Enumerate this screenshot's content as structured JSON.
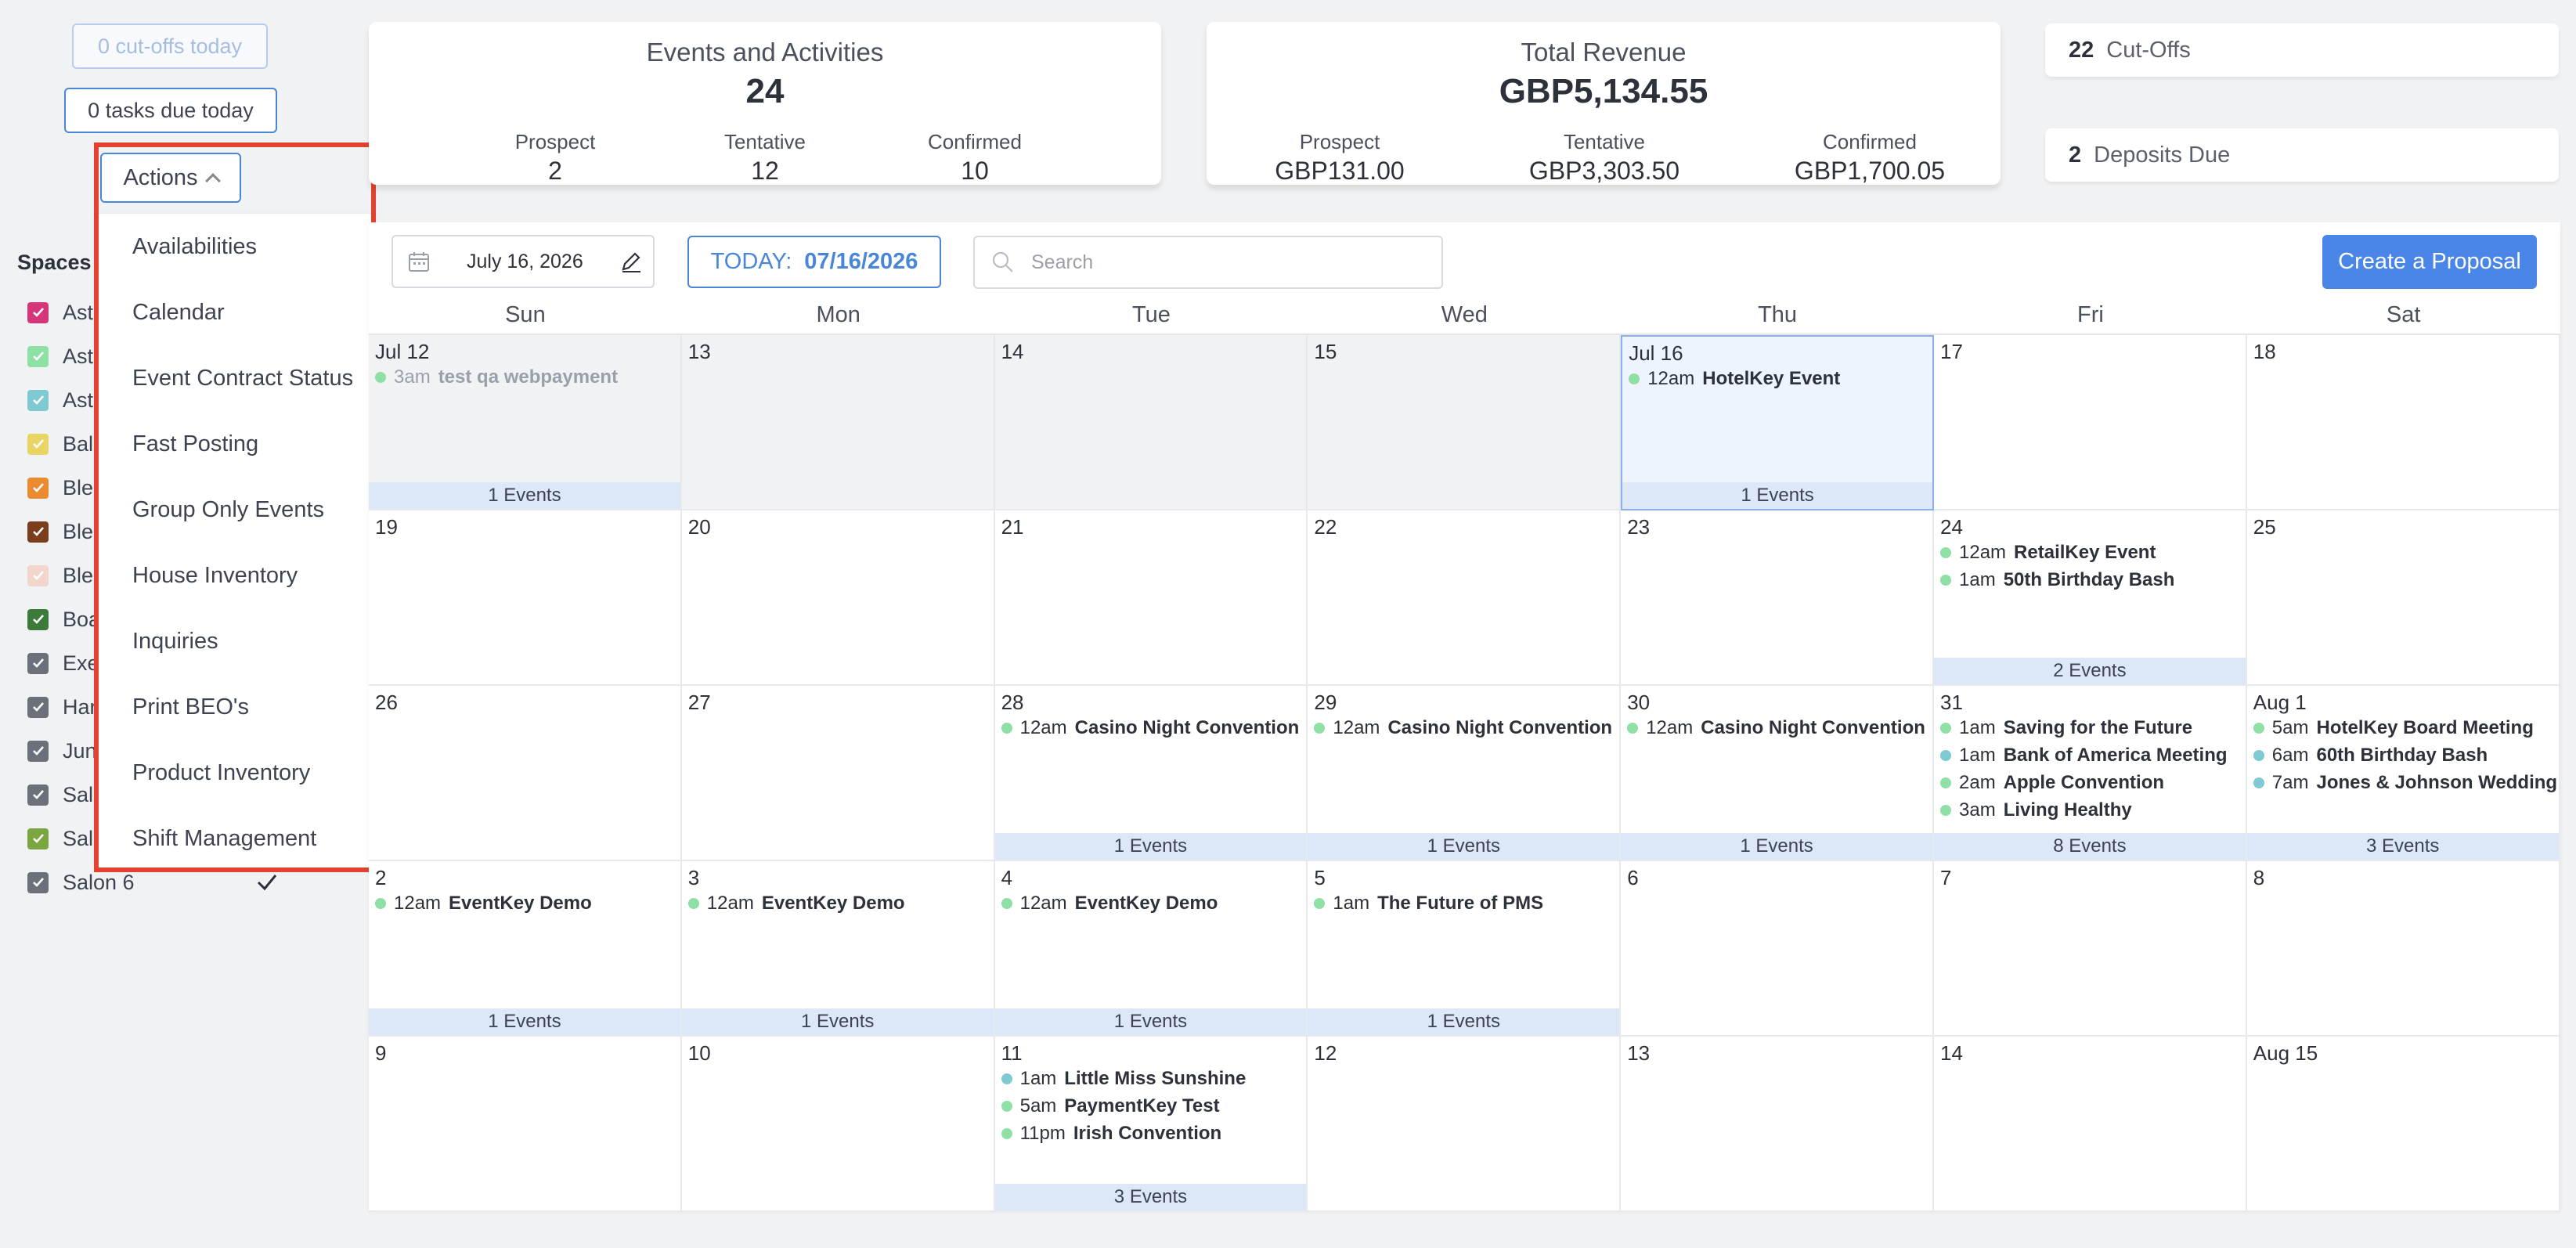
{
  "left": {
    "cutoffs_today": "0 cut-offs today",
    "tasks_due_today": "0 tasks due today",
    "actions_label": "Actions",
    "spaces_label": "Spaces",
    "spaces": [
      {
        "label": "Astr",
        "color": "#d6357a"
      },
      {
        "label": "Astr",
        "color": "#8fe0a4"
      },
      {
        "label": "Astr",
        "color": "#7fc9d2"
      },
      {
        "label": "Bal",
        "color": "#e8d565"
      },
      {
        "label": "Ble",
        "color": "#ec8a30"
      },
      {
        "label": "Ble",
        "color": "#7b3e1c"
      },
      {
        "label": "Ble",
        "color": "#f2d6cc"
      },
      {
        "label": "Boa",
        "color": "#3c7a3a"
      },
      {
        "label": "Exe",
        "color": "#6b707a"
      },
      {
        "label": "Har",
        "color": "#6b707a"
      },
      {
        "label": "Juni",
        "color": "#6b707a"
      },
      {
        "label": "Salo",
        "color": "#6b707a"
      },
      {
        "label": "Salo",
        "color": "#7aa63f"
      },
      {
        "label": "Salon 6",
        "color": "#6b707a"
      }
    ],
    "actions_menu": [
      "Availabilities",
      "Calendar",
      "Event Contract Status",
      "Fast Posting",
      "Group Only Events",
      "House Inventory",
      "Inquiries",
      "Print BEO's",
      "Product Inventory",
      "Shift Management"
    ]
  },
  "cards": {
    "events": {
      "title": "Events and Activities",
      "total": "24",
      "prospect_label": "Prospect",
      "prospect": "2",
      "tentative_label": "Tentative",
      "tentative": "12",
      "confirmed_label": "Confirmed",
      "confirmed": "10"
    },
    "revenue": {
      "title": "Total Revenue",
      "total": "GBP5,134.55",
      "prospect_label": "Prospect",
      "prospect": "GBP131.00",
      "tentative_label": "Tentative",
      "tentative": "GBP3,303.50",
      "confirmed_label": "Confirmed",
      "confirmed": "GBP1,700.05"
    },
    "cutoffs": {
      "count": "22",
      "label": "Cut-Offs"
    },
    "deposits": {
      "count": "2",
      "label": "Deposits Due"
    }
  },
  "toolbar": {
    "date": "July 16, 2026",
    "today_label": "TODAY:",
    "today_value": "07/16/2026",
    "search_placeholder": "Search",
    "create_proposal": "Create a Proposal"
  },
  "colors": {
    "accent": "#4a86e8",
    "green_dot": "#8fe0a4",
    "teal_dot": "#7fc9d2",
    "highlight": "#e2422f"
  },
  "calendar": {
    "days_of_week": [
      "Sun",
      "Mon",
      "Tue",
      "Wed",
      "Thu",
      "Fri",
      "Sat"
    ],
    "weeks": [
      [
        {
          "d": "Jul 12",
          "past": true,
          "events": [
            {
              "t": "3am",
              "n": "test qa webpayment",
              "c": "g"
            }
          ],
          "count": "1 Events"
        },
        {
          "d": "13",
          "past": true,
          "events": []
        },
        {
          "d": "14",
          "past": true,
          "events": []
        },
        {
          "d": "15",
          "past": true,
          "events": []
        },
        {
          "d": "Jul 16",
          "today": true,
          "events": [
            {
              "t": "12am",
              "n": "HotelKey Event",
              "c": "g"
            }
          ],
          "count": "1 Events"
        },
        {
          "d": "17",
          "events": []
        },
        {
          "d": "18",
          "events": []
        }
      ],
      [
        {
          "d": "19",
          "events": []
        },
        {
          "d": "20",
          "events": []
        },
        {
          "d": "21",
          "events": []
        },
        {
          "d": "22",
          "events": []
        },
        {
          "d": "23",
          "events": []
        },
        {
          "d": "24",
          "events": [
            {
              "t": "12am",
              "n": "RetailKey Event",
              "c": "g"
            },
            {
              "t": "1am",
              "n": "50th Birthday Bash",
              "c": "g"
            }
          ],
          "count": "2 Events"
        },
        {
          "d": "25",
          "events": []
        }
      ],
      [
        {
          "d": "26",
          "events": []
        },
        {
          "d": "27",
          "events": []
        },
        {
          "d": "28",
          "events": [
            {
              "t": "12am",
              "n": "Casino Night Convention",
              "c": "g"
            }
          ],
          "count": "1 Events"
        },
        {
          "d": "29",
          "events": [
            {
              "t": "12am",
              "n": "Casino Night Convention",
              "c": "g"
            }
          ],
          "count": "1 Events"
        },
        {
          "d": "30",
          "events": [
            {
              "t": "12am",
              "n": "Casino Night Convention",
              "c": "g"
            }
          ],
          "count": "1 Events"
        },
        {
          "d": "31",
          "events": [
            {
              "t": "1am",
              "n": "Saving for the Future",
              "c": "g"
            },
            {
              "t": "1am",
              "n": "Bank of America Meeting",
              "c": "t"
            },
            {
              "t": "2am",
              "n": "Apple Convention",
              "c": "g"
            },
            {
              "t": "3am",
              "n": "Living Healthy",
              "c": "g"
            }
          ],
          "count": "8 Events"
        },
        {
          "d": "Aug 1",
          "events": [
            {
              "t": "5am",
              "n": "HotelKey Board Meeting",
              "c": "g"
            },
            {
              "t": "6am",
              "n": "60th Birthday Bash",
              "c": "t"
            },
            {
              "t": "7am",
              "n": "Jones & Johnson Wedding",
              "c": "t"
            }
          ],
          "count": "3 Events"
        }
      ],
      [
        {
          "d": "2",
          "events": [
            {
              "t": "12am",
              "n": "EventKey Demo",
              "c": "g"
            }
          ],
          "count": "1 Events"
        },
        {
          "d": "3",
          "events": [
            {
              "t": "12am",
              "n": "EventKey Demo",
              "c": "g"
            }
          ],
          "count": "1 Events"
        },
        {
          "d": "4",
          "events": [
            {
              "t": "12am",
              "n": "EventKey Demo",
              "c": "g"
            }
          ],
          "count": "1 Events"
        },
        {
          "d": "5",
          "events": [
            {
              "t": "1am",
              "n": "The Future of PMS",
              "c": "g"
            }
          ],
          "count": "1 Events"
        },
        {
          "d": "6",
          "events": []
        },
        {
          "d": "7",
          "events": []
        },
        {
          "d": "8",
          "events": []
        }
      ],
      [
        {
          "d": "9",
          "events": []
        },
        {
          "d": "10",
          "events": []
        },
        {
          "d": "11",
          "events": [
            {
              "t": "1am",
              "n": "Little Miss Sunshine",
              "c": "t"
            },
            {
              "t": "5am",
              "n": "PaymentKey Test",
              "c": "g"
            },
            {
              "t": "11pm",
              "n": "Irish Convention",
              "c": "g"
            }
          ],
          "count": "3 Events"
        },
        {
          "d": "12",
          "events": []
        },
        {
          "d": "13",
          "events": []
        },
        {
          "d": "14",
          "events": []
        },
        {
          "d": "Aug 15",
          "events": []
        }
      ]
    ]
  }
}
